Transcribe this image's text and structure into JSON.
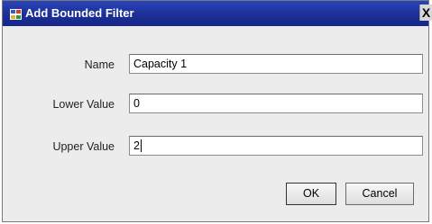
{
  "window": {
    "title": "Add Bounded Filter",
    "close_glyph": "X",
    "icon": "app-icon"
  },
  "form": {
    "fields": [
      {
        "label": "Name",
        "value": "Capacity 1"
      },
      {
        "label": "Lower Value",
        "value": "0"
      },
      {
        "label": "Upper Value",
        "value": "2"
      }
    ]
  },
  "buttons": {
    "ok_label": "OK",
    "cancel_label": "Cancel"
  }
}
